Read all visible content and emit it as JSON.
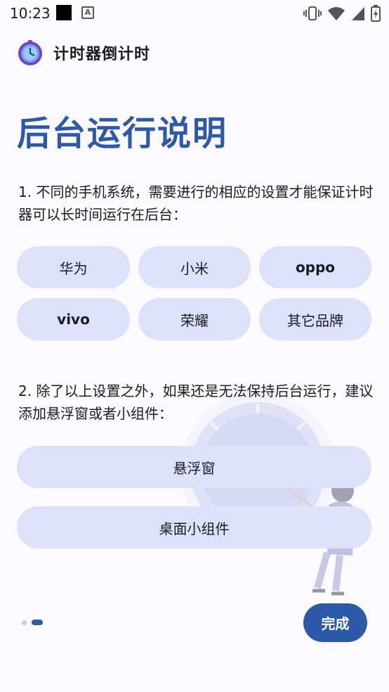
{
  "status_bar": {
    "time": "10:23"
  },
  "app": {
    "title": "计时器倒计时"
  },
  "page_title": "后台运行说明",
  "description_1": "1. 不同的手机系统，需要进行的相应的设置才能保证计时器可以长时间运行在后台：",
  "brands": [
    "华为",
    "小米",
    "oppo",
    "vivo",
    "荣耀",
    "其它品牌"
  ],
  "description_2": "2. 除了以上设置之外，如果还是无法保持后台运行，建议添加悬浮窗或者小组件：",
  "options": {
    "floating_window": "悬浮窗",
    "desktop_widget": "桌面小组件"
  },
  "pager": {
    "pages": 2,
    "current": 2
  },
  "done_label": "完成",
  "colors": {
    "accent": "#2c5aa8",
    "button_bg": "#dce2f9",
    "background": "#fcf9ff"
  }
}
